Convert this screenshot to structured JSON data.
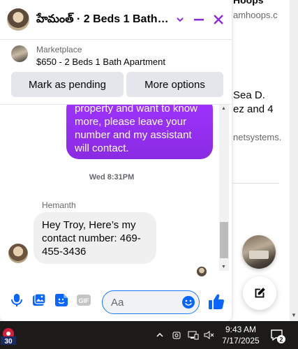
{
  "background": {
    "texts": [
      "Hoops",
      "amhoops.c",
      "Sea D.",
      "ez and 4",
      "netsystems."
    ]
  },
  "chat": {
    "title": "హేమంత్ · 2 Beds 1 Bath ...",
    "marketplace": {
      "label": "Marketplace",
      "title": "$650 - 2 Beds 1 Bath Apartment",
      "mark_pending_label": "Mark as pending",
      "more_options_label": "More options"
    },
    "messages": {
      "outgoing_text": "property and want to know more, please leave your number and my assistant will contact.",
      "time_separator": "Wed 8:31PM",
      "sender_name": "Hemanth",
      "incoming_text": "Hey Troy, Here’s my contact number: 469-455-3436"
    },
    "composer": {
      "placeholder": "Aa",
      "gif_label": "GIF"
    }
  },
  "taskbar": {
    "app_badge": "30",
    "time": "9:43 AM",
    "date": "7/17/2025",
    "notification_count": "2"
  },
  "colors": {
    "accent": "#8a2be2",
    "messenger_blue": "#0866ff",
    "bubble_out": "#a033ff",
    "bubble_in": "#f0f0f0",
    "taskbar": "#1c1b1a"
  }
}
